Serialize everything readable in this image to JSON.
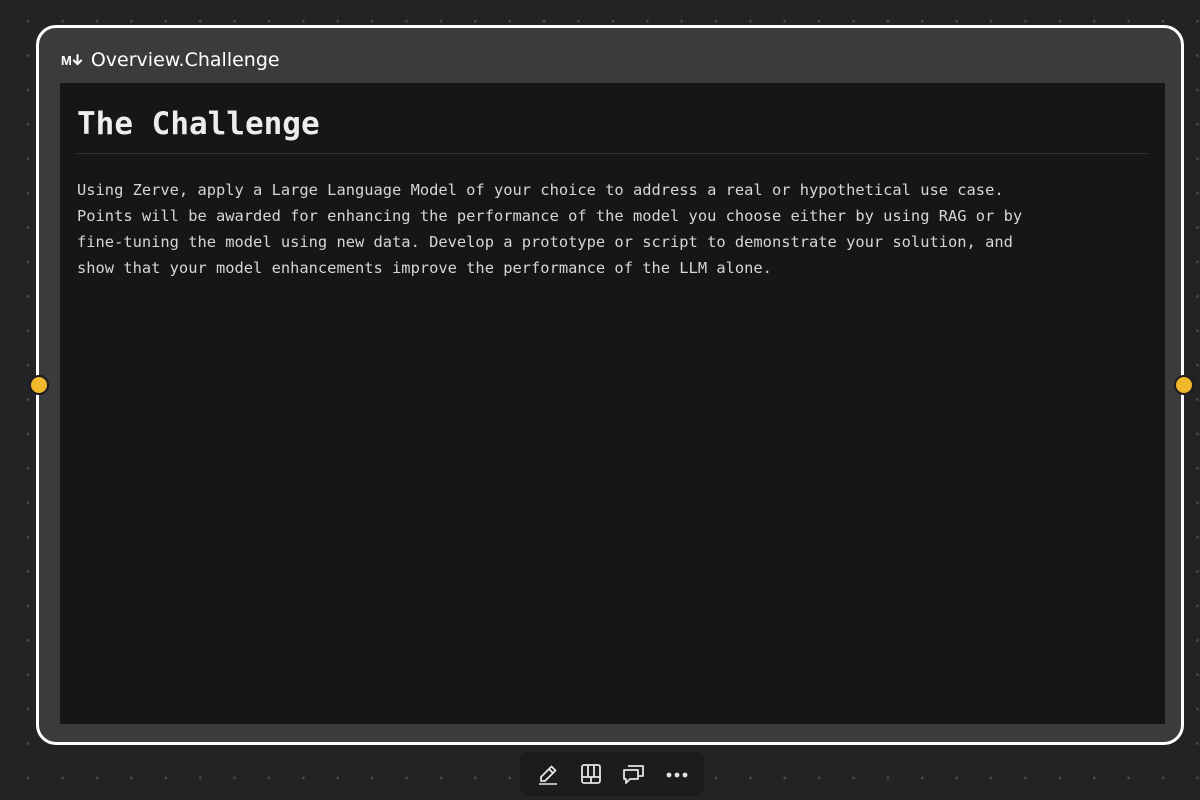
{
  "block": {
    "type_icon": "markdown-icon",
    "type_icon_text": "M",
    "title": "Overview.Challenge"
  },
  "content": {
    "heading": "The Challenge",
    "paragraph": "Using Zerve, apply a Large Language Model of your choice to address a real or hypothetical use case.\nPoints will be awarded for enhancing the performance of the model you choose either by using RAG or by\nfine-tuning the model using new data. Develop a prototype or script to demonstrate your solution, and\nshow that your model enhancements improve the performance of the LLM alone."
  },
  "handles": {
    "color": "#f2b82b",
    "items": [
      "connection-handle-left",
      "connection-handle-right"
    ]
  },
  "toolbar": {
    "items": [
      {
        "icon": "pencil-icon"
      },
      {
        "icon": "layout-grid-icon"
      },
      {
        "icon": "comment-icon"
      },
      {
        "icon": "more-icon"
      }
    ]
  },
  "colors": {
    "canvas": "#232224",
    "block_border": "#ffffff",
    "block_bg": "#3b3a3d",
    "content_bg": "#171617"
  }
}
